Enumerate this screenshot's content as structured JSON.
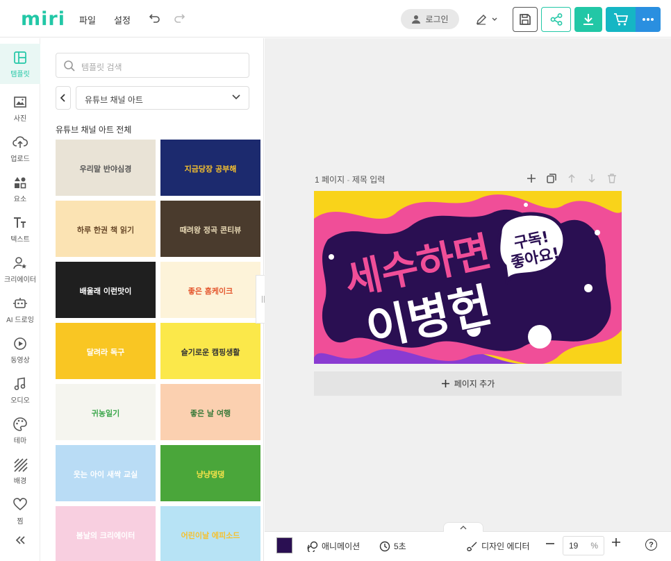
{
  "app": {
    "logo": "miri"
  },
  "menu": {
    "file": "파일",
    "settings": "설정"
  },
  "header": {
    "login": "로그인"
  },
  "sidebar": {
    "items": [
      {
        "label": "템플릿",
        "icon": "template-icon",
        "active": true
      },
      {
        "label": "사진",
        "icon": "photo-icon"
      },
      {
        "label": "업로드",
        "icon": "upload-icon"
      },
      {
        "label": "요소",
        "icon": "elements-icon"
      },
      {
        "label": "텍스트",
        "icon": "text-icon"
      },
      {
        "label": "크리에이터",
        "icon": "creator-icon"
      },
      {
        "label": "AI 드로잉",
        "icon": "ai-drawing-icon"
      },
      {
        "label": "동영상",
        "icon": "video-icon"
      },
      {
        "label": "오디오",
        "icon": "audio-icon"
      },
      {
        "label": "테마",
        "icon": "theme-icon"
      },
      {
        "label": "배경",
        "icon": "background-icon"
      },
      {
        "label": "찜",
        "icon": "heart-icon"
      }
    ]
  },
  "panel": {
    "search_placeholder": "템플릿 검색",
    "category": "유튜브 채널 아트",
    "section_title": "유튜브 채널 아트 전체",
    "thumbnails": [
      {
        "caption": "우리말 반야심경",
        "bg": "#e9e3d6",
        "fg": "#555"
      },
      {
        "caption": "지금당장 공부해",
        "bg": "#1c2a6e",
        "fg": "#f6c12e"
      },
      {
        "caption": "하루 한권 책 읽기",
        "bg": "#fbe3b3",
        "fg": "#6a4a2a"
      },
      {
        "caption": "때려왕 정곡 콘티뷰",
        "bg": "#4a3b2d",
        "fg": "#e8d9b5"
      },
      {
        "caption": "배울래 이런맛이",
        "bg": "#1f1f1f",
        "fg": "#ffffff"
      },
      {
        "caption": "좋은 홈케이크",
        "bg": "#fdf3d9",
        "fg": "#e4572e"
      },
      {
        "caption": "달려라 독구",
        "bg": "#f9c623",
        "fg": "#ffffff"
      },
      {
        "caption": "슬기로운 캠핑생활",
        "bg": "#fbe84a",
        "fg": "#333333"
      },
      {
        "caption": "귀농일기",
        "bg": "#f5f5ef",
        "fg": "#3aa64a"
      },
      {
        "caption": "좋은 날 여행",
        "bg": "#fbd0b0",
        "fg": "#3a7a3a"
      },
      {
        "caption": "웃는 아이 새싹 교실",
        "bg": "#b9dcf5",
        "fg": "#ffffff"
      },
      {
        "caption": "냥냥댕댕",
        "bg": "#4aa63a",
        "fg": "#f6e34a"
      },
      {
        "caption": "봄날의 크리에이터",
        "bg": "#f8cfe0",
        "fg": "#ffffff"
      },
      {
        "caption": "어린이날 에피소드",
        "bg": "#b7e3f5",
        "fg": "#f6c12e"
      }
    ]
  },
  "canvas": {
    "page_label": "1 페이지",
    "page_title_placeholder": "제목 입력",
    "add_page": "페이지 추가",
    "design": {
      "headline": "세수하면",
      "name": "이병헌",
      "bubble_line1": "구독!",
      "bubble_line2": "좋아요!",
      "colors": {
        "yellow": "#f9d31a",
        "purple": "#2a0f52",
        "pink": "#f04e98",
        "violet": "#8a3bd1"
      }
    }
  },
  "bottom": {
    "animation": "애니메이션",
    "duration": "5초",
    "design_editor": "디자인 에디터",
    "zoom_value": "19",
    "zoom_unit": "%"
  },
  "colors": {
    "accent": "#22c7a6",
    "cart": "#15b6c4",
    "more": "#2a8fe0"
  }
}
